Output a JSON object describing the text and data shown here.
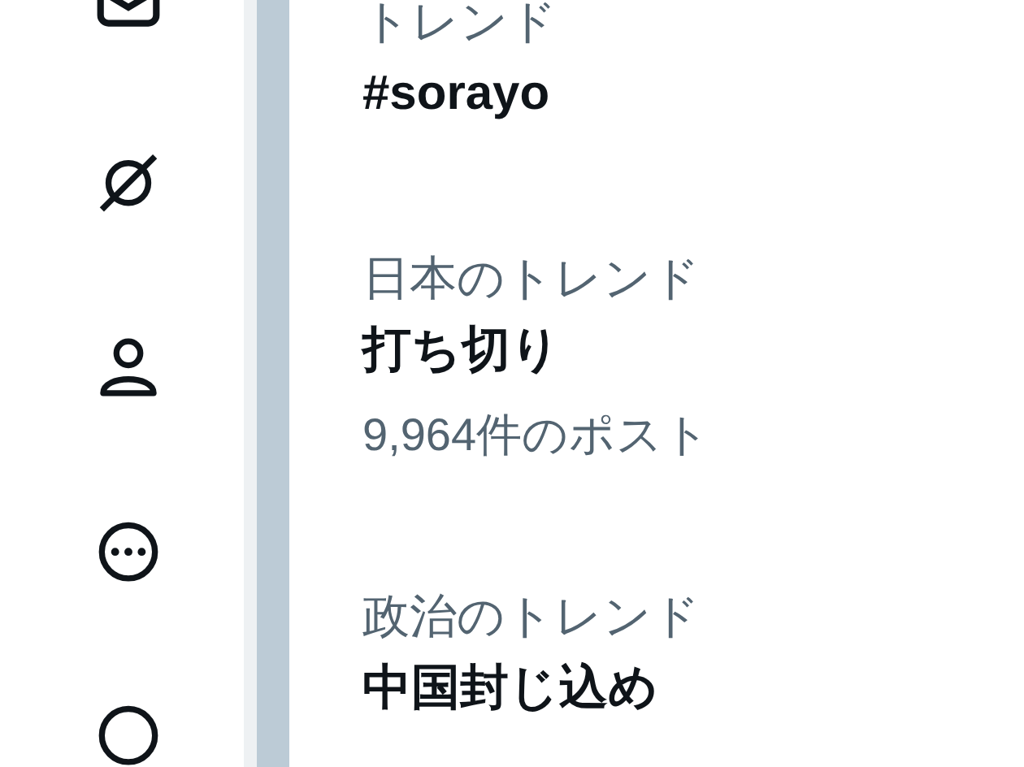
{
  "sidebar": {
    "items": [
      {
        "kind": "mail"
      },
      {
        "kind": "slash"
      },
      {
        "kind": "profile"
      },
      {
        "kind": "more"
      },
      {
        "kind": "circle"
      }
    ]
  },
  "trends": [
    {
      "context": "トレンド",
      "name": "#sorayo"
    },
    {
      "context": "日本のトレンド",
      "name": "打ち切り",
      "count": "9,964件のポスト"
    },
    {
      "context": "政治のトレンド",
      "name": "中国封じ込め"
    }
  ]
}
